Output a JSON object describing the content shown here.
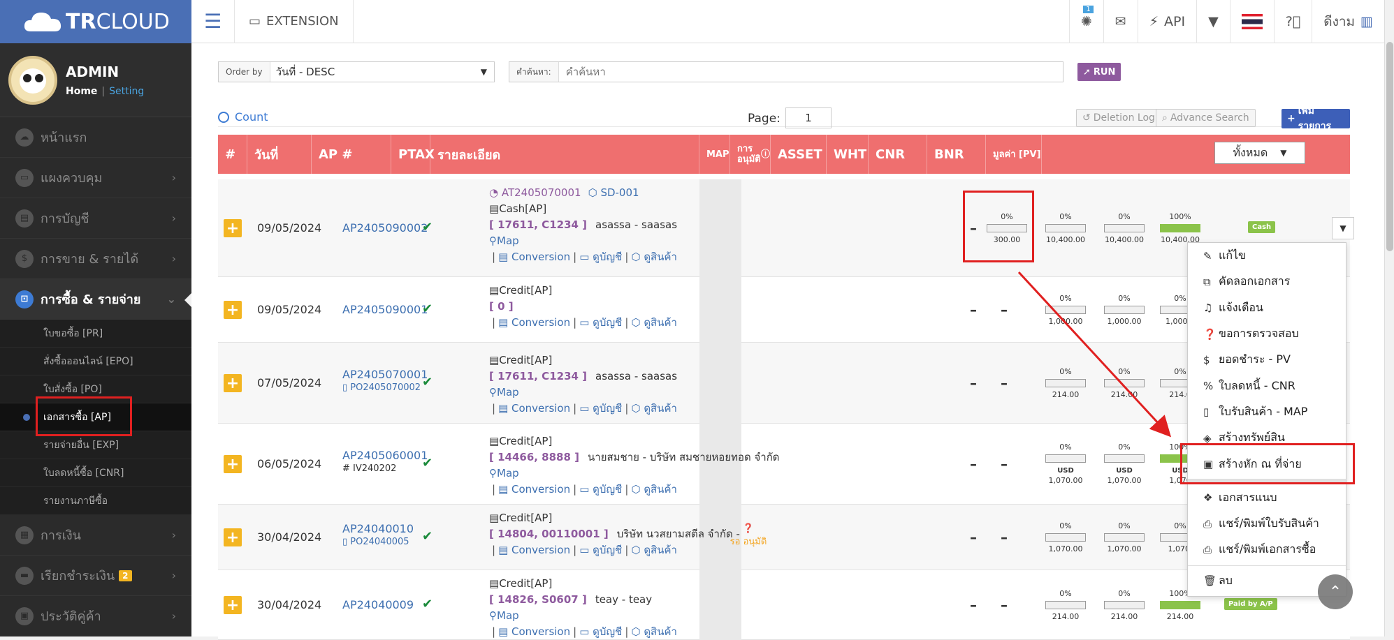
{
  "brand": {
    "bold": "TR",
    "rest": "CLOUD"
  },
  "profile": {
    "name": "ADMIN",
    "home": "Home",
    "sep": "|",
    "setting": "Setting"
  },
  "sidebar": {
    "items": [
      {
        "label": "หน้าแรก",
        "icon": "cloud-icon"
      },
      {
        "label": "แผงควบคุม",
        "icon": "monitor-icon"
      },
      {
        "label": "การบัญชี",
        "icon": "book-icon"
      },
      {
        "label": "การขาย & รายได้",
        "icon": "dollar-icon"
      },
      {
        "label": "การซื้อ & รายจ่าย",
        "icon": "cart-icon"
      }
    ],
    "sub": [
      "ใบขอซื้อ [PR]",
      "สั่งซื้อออนไลน์ [EPO]",
      "ใบสั่งซื้อ [PO]",
      "เอกสารซื้อ [AP]",
      "รายจ่ายอื่น [EXP]",
      "ใบลดหนี้ซื้อ [CNR]",
      "รายงานภาษีซื้อ"
    ],
    "after": [
      {
        "label": "การเงิน",
        "icon": "calendar-icon"
      },
      {
        "label": "เรียกชำระเงิน",
        "icon": "card-icon",
        "badge": "2"
      },
      {
        "label": "ประวัติคู่ค้า",
        "icon": "contact-icon"
      }
    ]
  },
  "topbar": {
    "extension": "EXTENSION",
    "notif_count": "1",
    "api": "API",
    "user": "ดีงาม"
  },
  "filter": {
    "order_label": "Order by",
    "order_value": "วันที่ - DESC",
    "search_label": "คำค้นหา:",
    "search_placeholder": "คำค้นหา",
    "run": "RUN"
  },
  "toolbar": {
    "count": "Count",
    "page_label": "Page:",
    "page_value": "1",
    "deletion_log": "Deletion Log",
    "advance_search": "Advance Search",
    "add": "เพิ่มรายการ"
  },
  "table": {
    "headers": [
      "#",
      "วันที่",
      "AP #",
      "PTAX",
      "รายละเอียด",
      "MAP",
      "การ อนุมัติ",
      "ASSET",
      "WHT",
      "CNR",
      "BNR",
      "มูลค่า [PV]"
    ],
    "filter_all": "ทั้งหมด",
    "link_conversion": "Conversion",
    "link_account": "ดูบัญชี",
    "link_product": "ดูสินค้า",
    "link_map": "Map",
    "rows": [
      {
        "date": "09/05/2024",
        "ap": "AP2405090002",
        "ref": "",
        "top1": "AT2405070001",
        "top2": "SD-001",
        "type": "Cash[AP]",
        "code": "[ 17611, C1234 ]",
        "party": "asassa - saasas",
        "map": true,
        "approval": "",
        "wht": {
          "pct": "0%",
          "amt": "300.00"
        },
        "cnr": {
          "pct": "0%",
          "amt": "10,400.00"
        },
        "bnr": {
          "pct": "0%",
          "amt": "10,400.00"
        },
        "pv": {
          "pct": "100%",
          "amt": "10,400.00",
          "full": true
        },
        "status": "Cash"
      },
      {
        "date": "09/05/2024",
        "ap": "AP2405090001",
        "ref": "",
        "type": "Credit[AP]",
        "code": "[ 0 ]",
        "party": "",
        "map": false,
        "approval": "",
        "cnr": {
          "pct": "0%",
          "amt": "1,000.00"
        },
        "bnr": {
          "pct": "0%",
          "amt": "1,000.00"
        },
        "pv": {
          "pct": "0%",
          "amt": "1,000.0"
        }
      },
      {
        "date": "07/05/2024",
        "ap": "AP2405070001",
        "ref": "PO2405070002",
        "type": "Credit[AP]",
        "code": "[ 17611, C1234 ]",
        "party": "asassa - saasas",
        "map": true,
        "approval": "",
        "cnr": {
          "pct": "0%",
          "amt": "214.00"
        },
        "bnr": {
          "pct": "0%",
          "amt": "214.00"
        },
        "pv": {
          "pct": "0%",
          "amt": "214.0"
        }
      },
      {
        "date": "06/05/2024",
        "ap": "AP2405060001",
        "ref": "IV240202",
        "type": "Credit[AP]",
        "code": "[ 14466, 8888 ]",
        "party": "นายสมชาย - บริษัท สมชายหอยทอด จำกัด",
        "map": true,
        "approval": "",
        "usd": "USD",
        "cnr": {
          "pct": "0%",
          "amt": "1,070.00"
        },
        "bnr": {
          "pct": "0%",
          "amt": "1,070.00"
        },
        "pv": {
          "pct": "100%",
          "amt": "1,070",
          "full": true
        }
      },
      {
        "date": "30/04/2024",
        "ap": "AP24040010",
        "ref": "PO24040005",
        "type": "Credit[AP]",
        "code": "[ 14804, 00110001 ]",
        "party": "บริษัท นวสยามสตีล จำกัด -",
        "map": false,
        "approval": "รอ อนุมัติ",
        "cnr": {
          "pct": "0%",
          "amt": "1,070.00"
        },
        "bnr": {
          "pct": "0%",
          "amt": "1,070.00"
        },
        "pv": {
          "pct": "0%",
          "amt": "1,070."
        }
      },
      {
        "date": "30/04/2024",
        "ap": "AP24040009",
        "ref": "",
        "type": "Credit[AP]",
        "code": "[ 14826, S0607 ]",
        "party": "teay - teay",
        "map": true,
        "approval": "",
        "cnr": {
          "pct": "0%",
          "amt": "214.00"
        },
        "bnr": {
          "pct": "0%",
          "amt": "214.00"
        },
        "pv": {
          "pct": "100%",
          "amt": "214.00",
          "full": true
        },
        "status": "Paid by A/P"
      }
    ]
  },
  "dropdown": [
    "แก้ไข",
    "คัดลอกเอกสาร",
    "แจ้งเตือน",
    "ขอการตรวจสอบ",
    "ยอดชำระ - PV",
    "ใบลดหนี้ - CNR",
    "ใบรับสินค้า - MAP",
    "สร้างทรัพย์สิน",
    "สร้างหัก ณ ที่จ่าย",
    "เอกสารแนบ",
    "แชร์/พิมพ์ใบรับสินค้า",
    "แชร์/พิมพ์เอกสารซื้อ",
    "ลบ"
  ],
  "colors": {
    "header": "#ef6f6f",
    "brand": "#4a6fb5",
    "accent": "#f3b521",
    "highlight": "#e02020"
  }
}
